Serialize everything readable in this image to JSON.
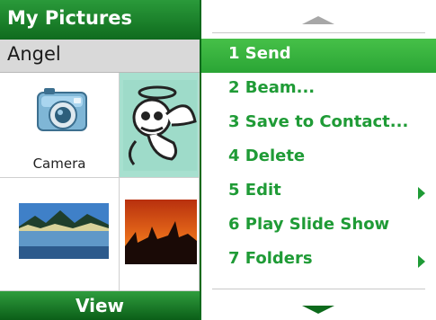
{
  "window": {
    "title": "My Pictures"
  },
  "subheader": {
    "name": "Angel"
  },
  "grid": {
    "items": [
      {
        "label": "Camera",
        "icon": "camera-icon"
      },
      {
        "label": "",
        "icon": "angel-cartoon-icon"
      },
      {
        "label": "",
        "icon": "lake-mountain-photo"
      },
      {
        "label": "",
        "icon": "sunset-desert-photo"
      }
    ]
  },
  "softkeys": {
    "left": "View"
  },
  "menu": {
    "items": [
      {
        "label": "1 Send",
        "active": true,
        "submenu": false
      },
      {
        "label": "2 Beam...",
        "active": false,
        "submenu": false
      },
      {
        "label": "3 Save to Contact...",
        "active": false,
        "submenu": false
      },
      {
        "label": "4 Delete",
        "active": false,
        "submenu": false
      },
      {
        "label": "5 Edit",
        "active": false,
        "submenu": true
      },
      {
        "label": "6 Play Slide Show",
        "active": false,
        "submenu": false
      },
      {
        "label": "7 Folders",
        "active": false,
        "submenu": true
      }
    ]
  },
  "colors": {
    "accent": "#2aa535",
    "menu_text": "#1f9b36"
  }
}
